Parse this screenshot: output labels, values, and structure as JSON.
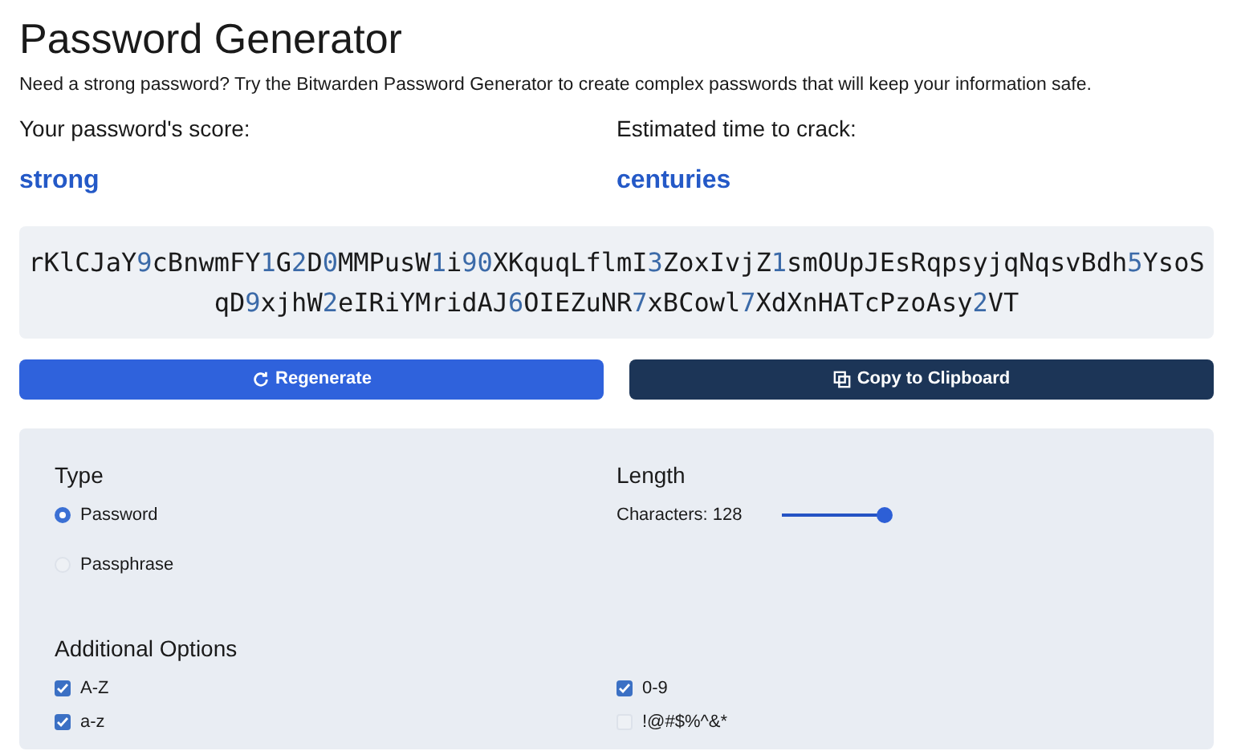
{
  "title": "Password Generator",
  "description": "Need a strong password? Try the Bitwarden Password Generator to create complex passwords that will keep your information safe.",
  "stats": [
    {
      "label": "Your password's score:",
      "value": "strong"
    },
    {
      "label": "Estimated time to crack:",
      "value": "centuries"
    }
  ],
  "password": "rKlCJaY9cBnwmFY1G2D0MMPusW1i90XKquqLflmI3ZoxIvjZ1smOUpJEsRqpsyjqNqsvBdh5YsoSqD9xjhW2eIRiYMridAJ6OIEZuNR7xBCowl7XdXnHATcPzoAsy2VT",
  "buttons": [
    {
      "kind": "regenerate",
      "label": "Regenerate"
    },
    {
      "kind": "copy",
      "label": "Copy to Clipboard"
    }
  ],
  "type": {
    "heading": "Type",
    "options": [
      {
        "label": "Password",
        "selected": true
      },
      {
        "label": "Passphrase",
        "selected": false
      }
    ]
  },
  "length": {
    "heading": "Length",
    "reading": "Characters: 128",
    "level": 1
  },
  "additional_options": {
    "heading": "Additional Options",
    "options": [
      {
        "label": "A-Z",
        "checked": true
      },
      {
        "label": "0-9",
        "checked": true
      },
      {
        "label": "a-z",
        "checked": true
      },
      {
        "label": "!@#$%^&*",
        "checked": false
      }
    ]
  }
}
